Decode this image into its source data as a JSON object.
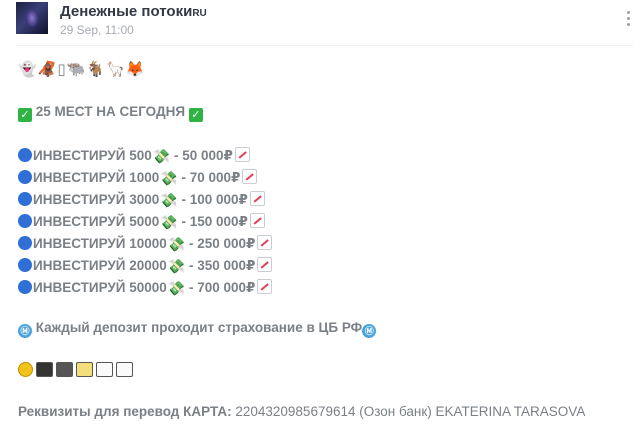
{
  "header": {
    "channel_name": "Денежные потоки",
    "channel_suffix": "RU",
    "date": "29 Sep, 11:00"
  },
  "post": {
    "top_emojis": [
      "👻",
      "🦧",
      "▯",
      "🐃",
      "🐐",
      "🦙",
      "🦊"
    ],
    "headline": "25 МЕСТ НА СЕГОДНЯ",
    "invest_lines": [
      {
        "label": "ИНВЕСТИРУЙ 500",
        "return": "- 50 000₽"
      },
      {
        "label": "ИНВЕСТИРУЙ 1000",
        "return": "- 70 000₽"
      },
      {
        "label": "ИНВЕСТИРУЙ 3000",
        "return": "- 100 000₽"
      },
      {
        "label": "ИНВЕСТИРУЙ 5000",
        "return": "- 150 000₽"
      },
      {
        "label": "ИНВЕСТИРУЙ 10000",
        "return": "- 250 000₽"
      },
      {
        "label": "ИНВЕСТИРУЙ 20000",
        "return": "- 350 000₽"
      },
      {
        "label": "ИНВЕСТИРУЙ 50000",
        "return": "- 700 000₽"
      }
    ],
    "insurance": "Каждый депозит проходит страхование в ЦБ РФ",
    "requisites_label": "Реквизиты для перевод КАРТА:",
    "requisites_value": "2204320985679614 (Озон банк) EKATERINA TARASOVA"
  },
  "colors": {
    "text": "#7b8087",
    "title": "#333a44",
    "check_green": "#2fb344",
    "dot_blue": "#2f6fd6"
  }
}
